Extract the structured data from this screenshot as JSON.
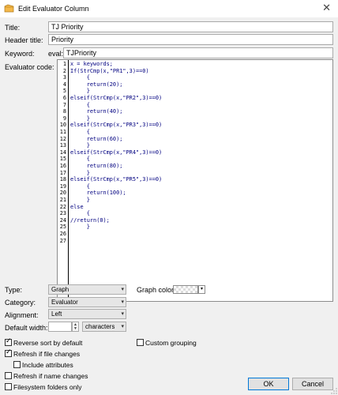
{
  "window": {
    "title": "Edit Evaluator Column"
  },
  "fields": {
    "title_label": "Title:",
    "title_value": "TJ Priority",
    "header_label": "Header title:",
    "header_value": "Priority",
    "keyword_label": "Keyword:",
    "keyword_prefix": "eval:",
    "keyword_value": "TJPriority",
    "code_label": "Evaluator code:"
  },
  "code_lines": [
    {
      "n": "1",
      "text": "x = keywords;"
    },
    {
      "n": "2",
      "text": "If(StrCmp(x,\"PR1\",3)==0)"
    },
    {
      "n": "3",
      "text": "     {"
    },
    {
      "n": "4",
      "text": "     return(20);"
    },
    {
      "n": "5",
      "text": "     }"
    },
    {
      "n": "6",
      "text": "elseif(StrCmp(x,\"PR2\",3)==0)"
    },
    {
      "n": "7",
      "text": "     {"
    },
    {
      "n": "8",
      "text": "     return(40);"
    },
    {
      "n": "9",
      "text": "     }"
    },
    {
      "n": "10",
      "text": "elseif(StrCmp(x,\"PR3\",3)==0)"
    },
    {
      "n": "11",
      "text": "     {"
    },
    {
      "n": "12",
      "text": "     return(60);"
    },
    {
      "n": "13",
      "text": "     }"
    },
    {
      "n": "14",
      "text": "elseif(StrCmp(x,\"PR4\",3)==0)"
    },
    {
      "n": "15",
      "text": "     {"
    },
    {
      "n": "16",
      "text": "     return(80);"
    },
    {
      "n": "17",
      "text": "     }"
    },
    {
      "n": "18",
      "text": "elseif(StrCmp(x,\"PR5\",3)==0)"
    },
    {
      "n": "19",
      "text": "     {"
    },
    {
      "n": "20",
      "text": "     return(100);"
    },
    {
      "n": "21",
      "text": "     }"
    },
    {
      "n": "22",
      "text": "else"
    },
    {
      "n": "23",
      "text": "     {"
    },
    {
      "n": "24",
      "text": "//return(0);"
    },
    {
      "n": "25",
      "text": "     }"
    },
    {
      "n": "26",
      "text": ""
    },
    {
      "n": "27",
      "text": ""
    }
  ],
  "options": {
    "type_label": "Type:",
    "type_value": "Graph",
    "graph_color_label": "Graph color:",
    "category_label": "Category:",
    "category_value": "Evaluator",
    "alignment_label": "Alignment:",
    "alignment_value": "Left",
    "width_label": "Default width:",
    "width_value": "",
    "width_unit": "characters"
  },
  "checkboxes": {
    "reverse_sort": {
      "label": "Reverse sort by default",
      "checked": true
    },
    "custom_grouping": {
      "label": "Custom grouping",
      "checked": false
    },
    "refresh_file": {
      "label": "Refresh if file changes",
      "checked": true
    },
    "include_attributes": {
      "label": "Include attributes",
      "checked": false
    },
    "refresh_name": {
      "label": "Refresh if name changes",
      "checked": false
    },
    "filesystem_only": {
      "label": "Filesystem folders only",
      "checked": false
    }
  },
  "buttons": {
    "ok": "OK",
    "cancel": "Cancel"
  },
  "colors": {
    "code_text": "#000080",
    "accent": "#0078d7"
  }
}
